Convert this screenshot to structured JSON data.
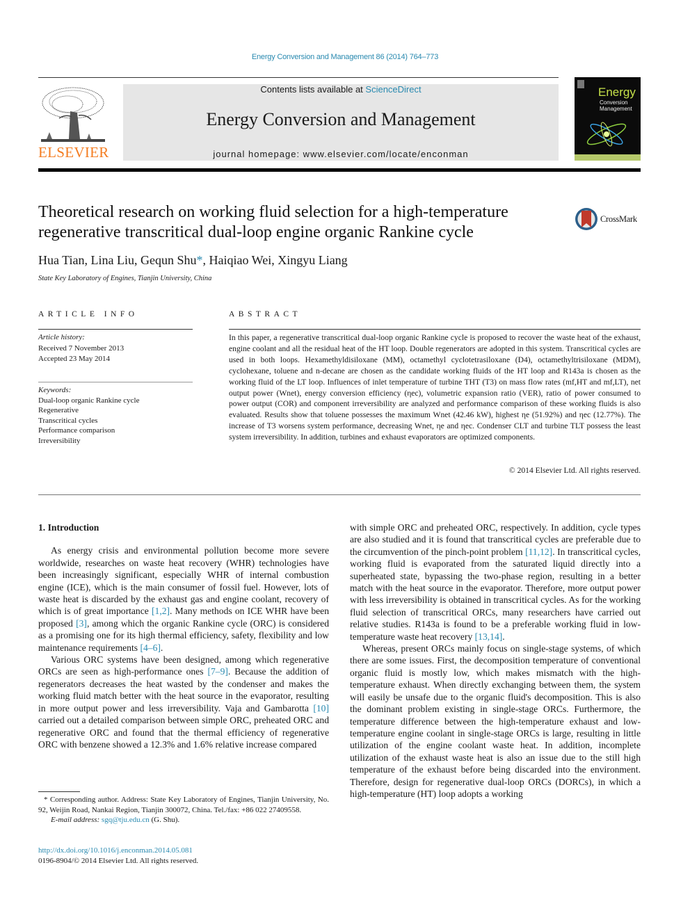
{
  "header": {
    "citation": "Energy Conversion and Management 86 (2014) 764–773",
    "contents_prefix": "Contents lists available at ",
    "contents_link": "ScienceDirect",
    "journal_title": "Energy Conversion and Management",
    "homepage": "journal homepage: www.elsevier.com/locate/enconman",
    "publisher_logo_text": "ELSEVIER",
    "cover": {
      "title": "Energy",
      "subtitle_line1": "Conversion",
      "subtitle_line2": "Management"
    },
    "colors": {
      "link": "#2a8ab0",
      "elsevier_orange": "#f47c20",
      "masthead_bg": "#e6e6e6"
    }
  },
  "article": {
    "title_line1": "Theoretical research on working fluid selection for a high-temperature",
    "title_line2": "regenerative transcritical dual-loop engine organic Rankine cycle",
    "crossmark_label": "CrossMark",
    "authors_before": "Hua Tian, Lina Liu, Gequn Shu",
    "corresponding_mark": "*",
    "authors_after": ", Haiqiao Wei, Xingyu Liang",
    "affiliation": "State Key Laboratory of Engines, Tianjin University, China"
  },
  "article_info": {
    "heading": "ARTICLE INFO",
    "history_label": "Article history:",
    "received": "Received 7 November 2013",
    "accepted": "Accepted 23 May 2014",
    "keywords_label": "Keywords:",
    "keywords": [
      "Dual-loop organic Rankine cycle",
      "Regenerative",
      "Transcritical cycles",
      "Performance comparison",
      "Irreversibility"
    ]
  },
  "abstract": {
    "heading": "ABSTRACT",
    "text": "In this paper, a regenerative transcritical dual-loop organic Rankine cycle is proposed to recover the waste heat of the exhaust, engine coolant and all the residual heat of the HT loop. Double regenerators are adopted in this system. Transcritical cycles are used in both loops. Hexamethyldisiloxane (MM), octamethyl cyclotetrasiloxane (D4), octamethyltrisiloxane (MDM), cyclohexane, toluene and n-decane are chosen as the candidate working fluids of the HT loop and R143a is chosen as the working fluid of the LT loop. Influences of inlet temperature of turbine THT (T3) on mass flow rates (mf,HT and mf,LT), net output power (Wnet), energy conversion efficiency (ηec), volumetric expansion ratio (VER), ratio of power consumed to power output (COR) and component irreversibility are analyzed and performance comparison of these working fluids is also evaluated. Results show that toluene possesses the maximum Wnet (42.46 kW), highest ηe (51.92%) and ηec (12.77%). The increase of T3 worsens system performance, decreasing Wnet, ηe and ηec. Condenser CLT and turbine TLT possess the least system irreversibility. In addition, turbines and exhaust evaporators are optimized components.",
    "copyright": "© 2014 Elsevier Ltd. All rights reserved."
  },
  "body": {
    "section_heading": "1. Introduction",
    "left_paragraphs": [
      {
        "parts": [
          {
            "t": "As energy crisis and environmental pollution become more severe worldwide, researches on waste heat recovery (WHR) technologies have been increasingly significant, especially WHR of internal combustion engine (ICE), which is the main consumer of fossil fuel. However, lots of waste heat is discarded by the exhaust gas and engine coolant, recovery of which is of great importance "
          },
          {
            "ref": "[1,2]"
          },
          {
            "t": ". Many methods on ICE WHR have been proposed "
          },
          {
            "ref": "[3]"
          },
          {
            "t": ", among which the organic Rankine cycle (ORC) is considered as a promising one for its high thermal efficiency, safety, flexibility and low maintenance requirements "
          },
          {
            "ref": "[4–6]"
          },
          {
            "t": "."
          }
        ]
      },
      {
        "parts": [
          {
            "t": "Various ORC systems have been designed, among which regenerative ORCs are seen as high-performance ones "
          },
          {
            "ref": "[7–9]"
          },
          {
            "t": ". Because the addition of regenerators decreases the heat wasted by the condenser and makes the working fluid match better with the heat source in the evaporator, resulting in more output power and less irreversibility. Vaja and Gambarotta "
          },
          {
            "ref": "[10]"
          },
          {
            "t": " carried out a detailed comparison between simple ORC, preheated ORC and regenerative ORC and found that the thermal efficiency of regenerative ORC with benzene showed a 12.3% and 1.6% relative increase compared"
          }
        ]
      }
    ],
    "right_paragraphs": [
      {
        "noindent": true,
        "parts": [
          {
            "t": "with simple ORC and preheated ORC, respectively. In addition, cycle types are also studied and it is found that transcritical cycles are preferable due to the circumvention of the pinch-point problem "
          },
          {
            "ref": "[11,12]"
          },
          {
            "t": ". In transcritical cycles, working fluid is evaporated from the saturated liquid directly into a superheated state, bypassing the two-phase region, resulting in a better match with the heat source in the evaporator. Therefore, more output power with less irreversibility is obtained in transcritical cycles. As for the working fluid selection of transcritical ORCs, many researchers have carried out relative studies. R143a is found to be a preferable working fluid in low-temperature waste heat recovery "
          },
          {
            "ref": "[13,14]"
          },
          {
            "t": "."
          }
        ]
      },
      {
        "parts": [
          {
            "t": "Whereas, present ORCs mainly focus on single-stage systems, of which there are some issues. First, the decomposition temperature of conventional organic fluid is mostly low, which makes mismatch with the high-temperature exhaust. When directly exchanging between them, the system will easily be unsafe due to the organic fluid's decomposition. This is also the dominant problem existing in single-stage ORCs. Furthermore, the temperature difference between the high-temperature exhaust and low-temperature engine coolant in single-stage ORCs is large, resulting in little utilization of the engine coolant waste heat. In addition, incomplete utilization of the exhaust waste heat is also an issue due to the still high temperature of the exhaust before being discarded into the environment. Therefore, design for regenerative dual-loop ORCs (DORCs), in which a high-temperature (HT) loop adopts a working"
          }
        ]
      }
    ]
  },
  "footnote": {
    "corresponding": "* Corresponding author. Address: State Key Laboratory of Engines, Tianjin University, No. 92, Weijin Road, Nankai Region, Tianjin 300072, China. Tel./fax: +86 022 27409558.",
    "email_label": "E-mail address: ",
    "email": "sgq@tju.edu.cn",
    "email_suffix": " (G. Shu).",
    "doi": "http://dx.doi.org/10.1016/j.enconman.2014.05.081",
    "issn": "0196-8904/© 2014 Elsevier Ltd. All rights reserved."
  }
}
